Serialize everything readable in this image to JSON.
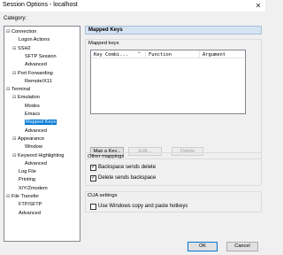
{
  "window": {
    "title": "Session Options - localhost",
    "close_glyph": "✕"
  },
  "category_label": "Category:",
  "tree": [
    {
      "label": "Connection",
      "toggle": "⊟",
      "indent": 0
    },
    {
      "label": "Logon Actions",
      "toggle": "",
      "indent": 2
    },
    {
      "label": "SSH2",
      "toggle": "⊟",
      "indent": 1
    },
    {
      "label": "SFTP Session",
      "toggle": "",
      "indent": 3
    },
    {
      "label": "Advanced",
      "toggle": "",
      "indent": 3
    },
    {
      "label": "Port Forwarding",
      "toggle": "⊟",
      "indent": 1
    },
    {
      "label": "Remote/X11",
      "toggle": "",
      "indent": 3
    },
    {
      "label": "Terminal",
      "toggle": "⊟",
      "indent": 0
    },
    {
      "label": "Emulation",
      "toggle": "⊟",
      "indent": 1
    },
    {
      "label": "Modes",
      "toggle": "",
      "indent": 3
    },
    {
      "label": "Emacs",
      "toggle": "",
      "indent": 3
    },
    {
      "label": "Mapped Keys",
      "toggle": "",
      "indent": 3,
      "selected": true
    },
    {
      "label": "Advanced",
      "toggle": "",
      "indent": 3
    },
    {
      "label": "Appearance",
      "toggle": "⊟",
      "indent": 1
    },
    {
      "label": "Window",
      "toggle": "",
      "indent": 3
    },
    {
      "label": "Keyword Highlighting",
      "toggle": "⊟",
      "indent": 1
    },
    {
      "label": "Advanced",
      "toggle": "",
      "indent": 3
    },
    {
      "label": "Log File",
      "toggle": "",
      "indent": 2
    },
    {
      "label": "Printing",
      "toggle": "",
      "indent": 2
    },
    {
      "label": "X/Y/Zmodem",
      "toggle": "",
      "indent": 2
    },
    {
      "label": "File Transfer",
      "toggle": "⊟",
      "indent": 0
    },
    {
      "label": "FTP/SFTP",
      "toggle": "",
      "indent": 2
    },
    {
      "label": "Advanced",
      "toggle": "",
      "indent": 2
    }
  ],
  "panel": {
    "header": "Mapped Keys",
    "mapped_keys_group": "Mapped keys",
    "columns": [
      "Key Combi...",
      "Function",
      "Argument"
    ],
    "sort_glyph": "^",
    "buttons": {
      "map": "Map a Key...",
      "edit": "Edit...",
      "delete": "Delete"
    },
    "other_mappings": {
      "title": "Other mappings",
      "backspace_delete": {
        "label": "Backspace sends delete",
        "checked": true
      },
      "delete_backspace": {
        "label": "Delete sends backspace",
        "checked": true
      }
    },
    "cua": {
      "title": "CUA settings",
      "windows_hotkeys": {
        "label": "Use Windows copy and paste hotkeys",
        "checked": false
      }
    }
  },
  "footer": {
    "ok": "OK",
    "cancel": "Cancel"
  },
  "check_glyph": "✓",
  "colors": {
    "selection": "#0078d7",
    "header_bar": "#d5e3f3"
  }
}
